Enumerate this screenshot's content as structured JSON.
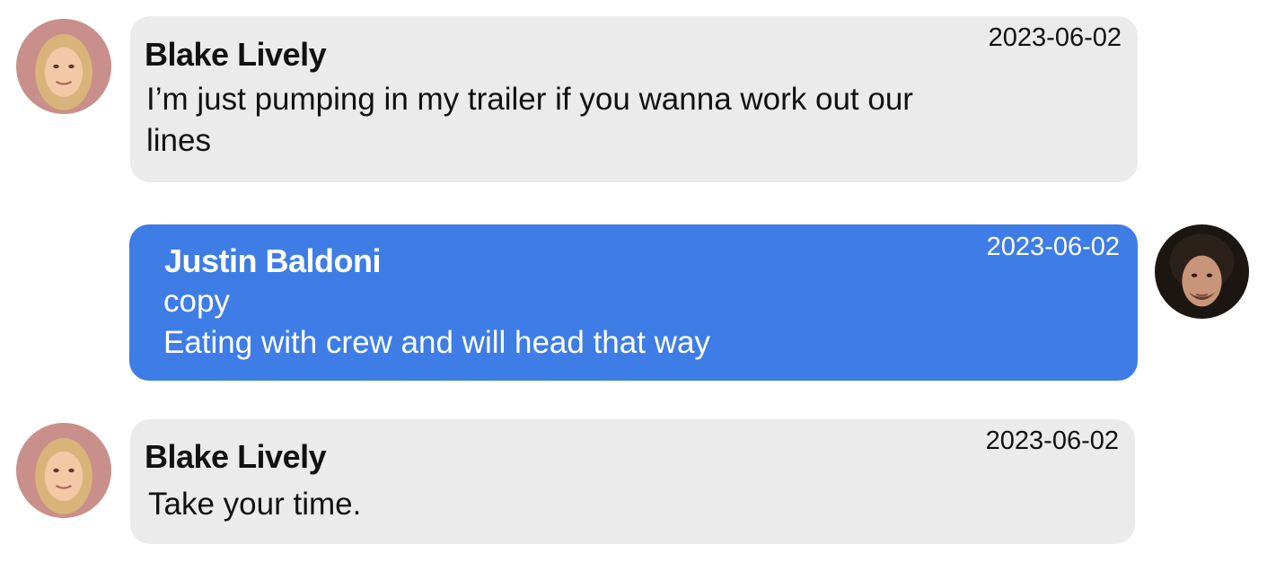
{
  "messages": [
    {
      "sender": "Blake Lively",
      "date": "2023-06-02",
      "lines": [
        "I’m just pumping in my trailer if you wanna work out our",
        "lines"
      ],
      "direction": "incoming",
      "avatar": "blonde-woman-avatar"
    },
    {
      "sender": "Justin Baldoni",
      "date": "2023-06-02",
      "lines": [
        "copy",
        "Eating with crew and will head that way"
      ],
      "direction": "outgoing",
      "avatar": "dark-haired-man-avatar"
    },
    {
      "sender": "Blake Lively",
      "date": "2023-06-02",
      "lines": [
        "Take your time."
      ],
      "direction": "incoming",
      "avatar": "blonde-woman-avatar"
    }
  ],
  "colors": {
    "incoming_bubble": "#ebebeb",
    "outgoing_bubble": "#3e7de6",
    "incoming_text": "#111111",
    "outgoing_text": "#ffffff"
  }
}
